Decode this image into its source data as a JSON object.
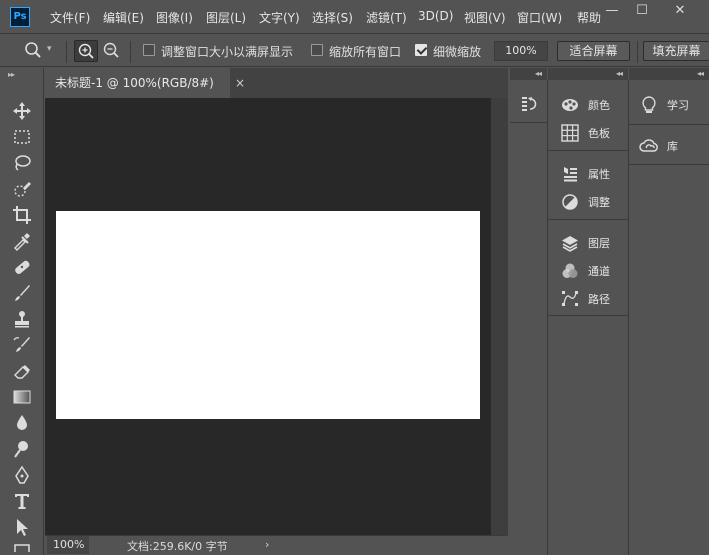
{
  "app": {
    "logo_text": "Ps"
  },
  "menu": [
    "文件(F)",
    "编辑(E)",
    "图像(I)",
    "图层(L)",
    "文字(Y)",
    "选择(S)",
    "滤镜(T)",
    "3D(D)",
    "视图(V)",
    "窗口(W)",
    "帮助"
  ],
  "window_controls": {
    "minimize": "—",
    "restore": "☐",
    "close": "✕"
  },
  "options": {
    "fit_window_label": "调整窗口大小以满屏显示",
    "fit_window_checked": false,
    "zoom_all_label": "缩放所有窗口",
    "zoom_all_checked": false,
    "scrubby_label": "细微缩放",
    "scrubby_checked": true,
    "zoom_value": "100%",
    "fit_screen_label": "适合屏幕",
    "fill_screen_label": "填充屏幕"
  },
  "document": {
    "tab_title": "未标题-1 @ 100%(RGB/8#)",
    "close_glyph": "×",
    "canvas_bg": "#282828",
    "page_bg": "#ffffff"
  },
  "status": {
    "zoom": "100%",
    "info": "文档:259.6K/0 字节",
    "arrow": "›"
  },
  "panels": {
    "col2": [
      {
        "icon": "palette-icon",
        "label": "颜色"
      },
      {
        "icon": "grid-icon",
        "label": "色板"
      },
      {
        "icon": "properties-icon",
        "label": "属性"
      },
      {
        "icon": "adjust-icon",
        "label": "调整"
      },
      {
        "icon": "layers-icon",
        "label": "图层"
      },
      {
        "icon": "channels-icon",
        "label": "通道"
      },
      {
        "icon": "paths-icon",
        "label": "路径"
      }
    ],
    "col3": [
      {
        "icon": "bulb-icon",
        "label": "学习"
      },
      {
        "icon": "cloud-icon",
        "label": "库"
      }
    ]
  },
  "colors": {
    "ui_bg": "#535353",
    "dark_bg": "#282828",
    "accent": "#31a8ff"
  }
}
